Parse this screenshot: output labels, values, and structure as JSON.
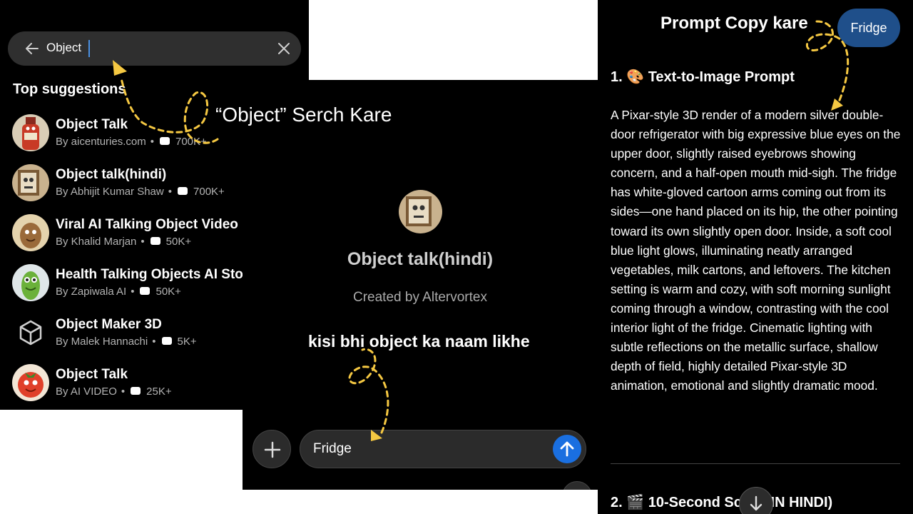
{
  "search": {
    "value": "Object",
    "placeholder": ""
  },
  "suggestions_title": "Top suggestions",
  "suggestions": [
    {
      "name": "Object Talk",
      "author": "By aicenturies.com",
      "count": "700K+",
      "avatar": "bottle"
    },
    {
      "name": "Object talk(hindi)",
      "author": "By Abhijit Kumar Shaw",
      "count": "700K+",
      "avatar": "frame"
    },
    {
      "name": "Viral AI Talking Object Video",
      "author": "By Khalid Marjan",
      "count": "50K+",
      "avatar": "wood"
    },
    {
      "name": "Health Talking Objects AI Stories",
      "author": "By Zapiwala AI",
      "count": "50K+",
      "avatar": "pickle"
    },
    {
      "name": "Object Maker 3D",
      "author": "By Malek Hannachi",
      "count": "5K+",
      "avatar": "cube"
    },
    {
      "name": "Object Talk",
      "author": "By AI VIDEO",
      "count": "25K+",
      "avatar": "tomato"
    }
  ],
  "gpt": {
    "name": "Object talk(hindi)",
    "creator": "Created by Altervortex"
  },
  "composer": {
    "value": "Fridge"
  },
  "response": {
    "heading1": "1. 🎨 Text-to-Image Prompt",
    "body": "A Pixar-style 3D render of a modern silver double-door refrigerator with big expressive blue eyes on the upper door, slightly raised eyebrows showing concern, and a half-open mouth mid-sigh. The fridge has white-gloved cartoon arms coming out from its sides—one hand placed on its hip, the other pointing toward its own slightly open door. Inside, a soft cool blue light glows, illuminating neatly arranged vegetables, milk cartons, and leftovers. The kitchen setting is warm and cozy, with soft morning sunlight coming through a window, contrasting with the cool interior light of the fridge. Cinematic lighting with subtle reflections on the metallic surface, shallow depth of field, highly detailed Pixar-style 3D animation, emotional and slightly dramatic mood.",
    "heading2": "2. 🎬 10-Second Sc",
    "heading2_tail": "(IN HINDI)",
    "user_bubble": "Fridge"
  },
  "annotations": {
    "search": "“Object” Serch Kare",
    "copy": "Prompt Copy kare",
    "type": "kisi bhi object ka naam likhe"
  },
  "colors": {
    "accent": "#1a6fe0",
    "pill": "#1f4f8a",
    "arrow": "#f5c842"
  }
}
